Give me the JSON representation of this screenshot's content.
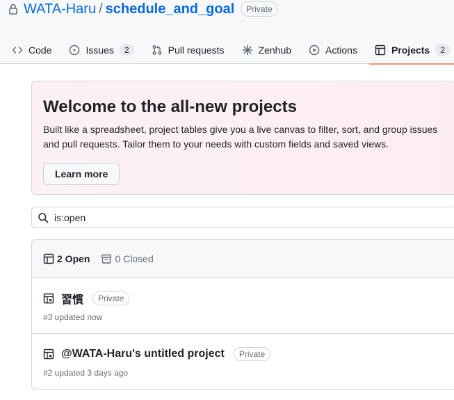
{
  "repo": {
    "owner": "WATA-Haru",
    "separator": "/",
    "name": "schedule_and_goal",
    "visibility": "Private"
  },
  "nav": {
    "tabs": [
      {
        "label": "Code",
        "icon": "code-icon"
      },
      {
        "label": "Issues",
        "icon": "issue-opened-icon",
        "count": "2"
      },
      {
        "label": "Pull requests",
        "icon": "git-pull-request-icon"
      },
      {
        "label": "Zenhub",
        "icon": "zenhub-icon"
      },
      {
        "label": "Actions",
        "icon": "play-icon"
      },
      {
        "label": "Projects",
        "icon": "table-icon",
        "count": "2",
        "selected": true
      }
    ]
  },
  "welcome": {
    "title": "Welcome to the all-new projects",
    "description": "Built like a spreadsheet, project tables give you a live canvas to filter, sort, and group issues and pull requests. Tailor them to your needs with custom fields and saved views.",
    "button": "Learn more"
  },
  "search": {
    "value": "is:open"
  },
  "projects": {
    "open_label": "2 Open",
    "closed_label": "0 Closed",
    "items": [
      {
        "name": "習慣",
        "visibility": "Private",
        "meta": "#3 updated now"
      },
      {
        "name": "@WATA-Haru's untitled project",
        "visibility": "Private",
        "meta": "#2 updated 3 days ago"
      }
    ]
  },
  "colors": {
    "link": "#0969da",
    "selected_underline": "#fd8c73",
    "muted": "#656d76",
    "border": "#d0d7de"
  }
}
